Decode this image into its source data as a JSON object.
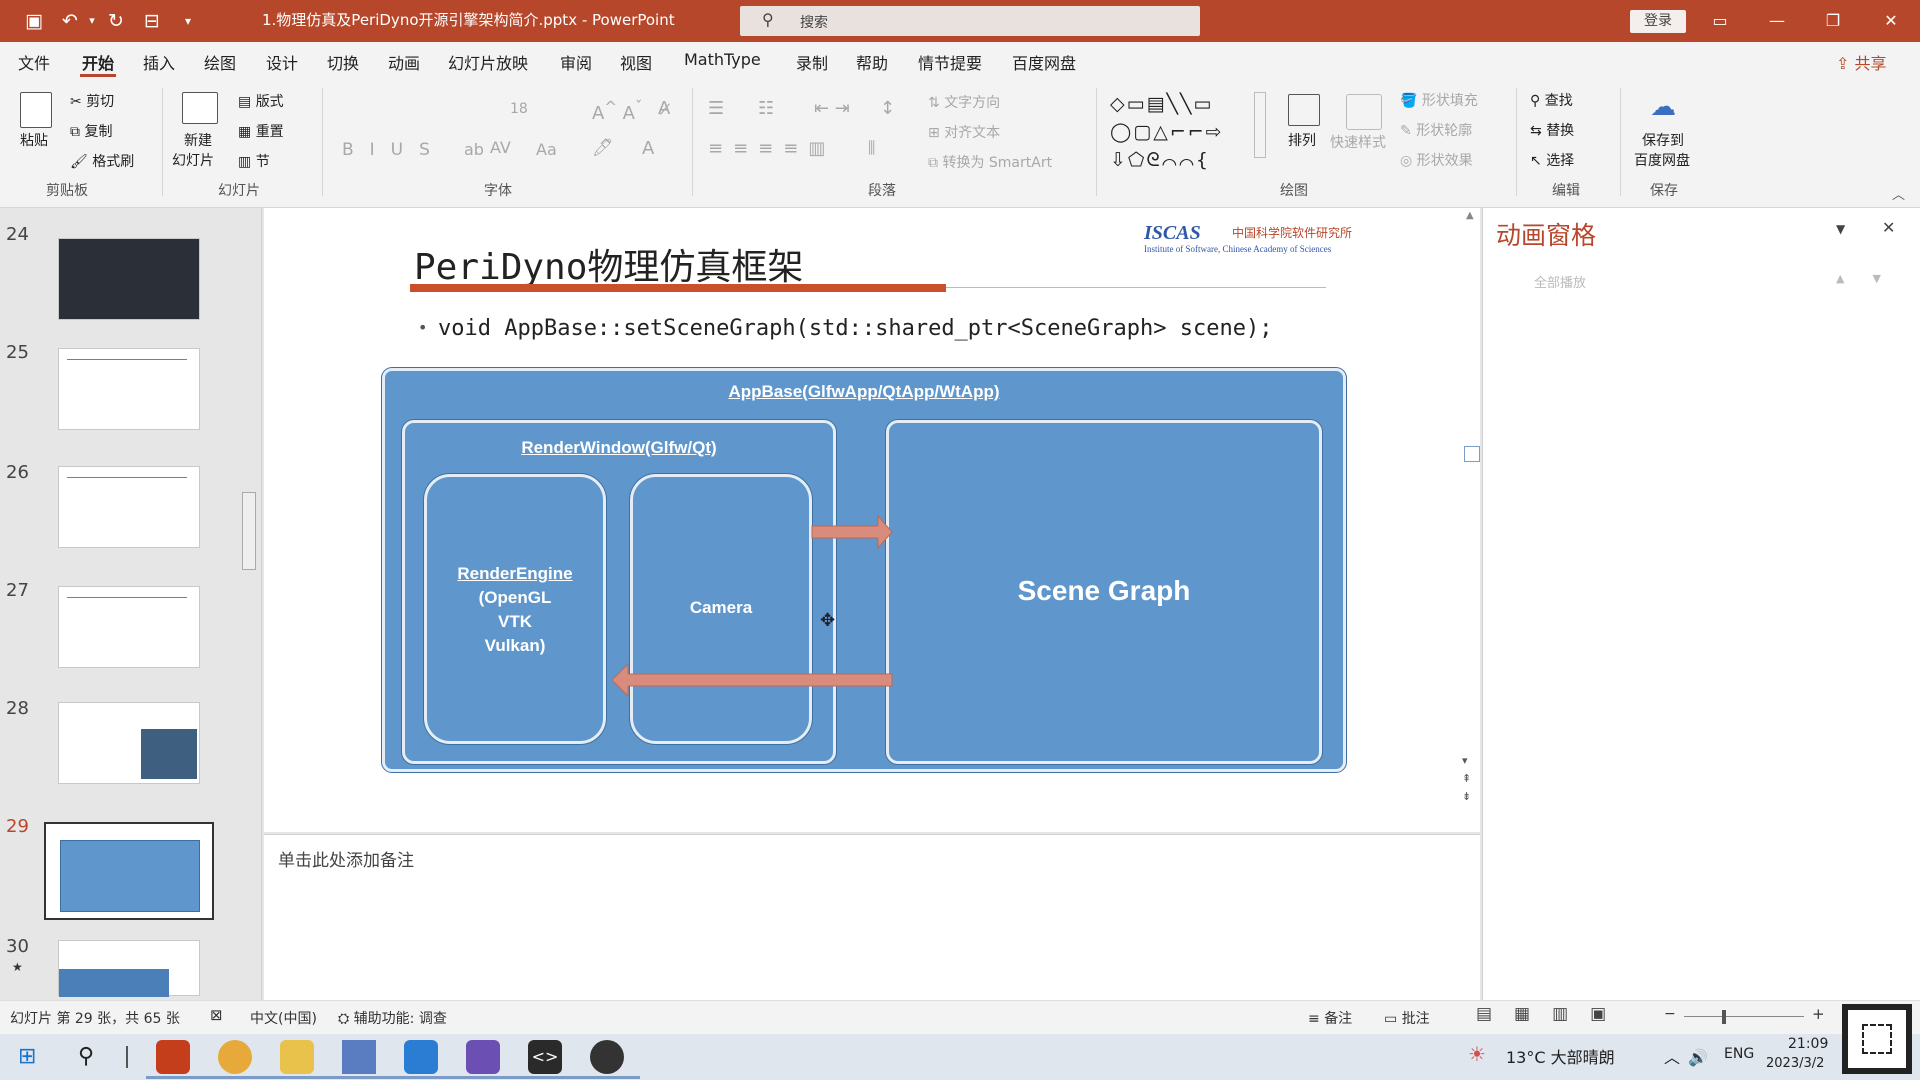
{
  "window": {
    "doc_title": "1.物理仿真及PeriDyno开源引擎架构简介.pptx  -  PowerPoint",
    "search_placeholder": "搜索",
    "login_label": "登录",
    "share_label": "共享"
  },
  "quick_access": [
    "save-icon",
    "undo-icon",
    "redo-icon",
    "present-icon",
    "more-icon"
  ],
  "menu": [
    "文件",
    "开始",
    "插入",
    "绘图",
    "设计",
    "切换",
    "动画",
    "幻灯片放映",
    "审阅",
    "视图",
    "MathType",
    "录制",
    "帮助",
    "情节提要",
    "百度网盘"
  ],
  "ribbon": {
    "clipboard": {
      "paste": "粘贴",
      "cut": "剪切",
      "copy": "复制",
      "format_painter": "格式刷",
      "group": "剪贴板"
    },
    "slides": {
      "new_slide_1": "新建",
      "new_slide_2": "幻灯片",
      "layout": "版式",
      "reset": "重置",
      "section": "节",
      "group": "幻灯片"
    },
    "font": {
      "size": "18",
      "group": "字体"
    },
    "paragraph": {
      "text_direction": "文字方向",
      "align_text": "对齐文本",
      "smartart": "转换为 SmartArt",
      "group": "段落"
    },
    "drawing": {
      "arrange": "排列",
      "quick_styles": "快速样式",
      "shape_fill": "形状填充",
      "shape_outline": "形状轮廓",
      "shape_effects": "形状效果",
      "group": "绘图"
    },
    "editing": {
      "find": "查找",
      "replace": "替换",
      "select": "选择",
      "group": "编辑"
    },
    "save": {
      "label_1": "保存到",
      "label_2": "百度网盘",
      "group": "保存"
    }
  },
  "thumbnails": [
    {
      "num": "24"
    },
    {
      "num": "25"
    },
    {
      "num": "26"
    },
    {
      "num": "27"
    },
    {
      "num": "28"
    },
    {
      "num": "29"
    },
    {
      "num": "30",
      "star": "★"
    }
  ],
  "slide": {
    "title": "PeriDyno物理仿真框架",
    "logo_text": "ISCAS",
    "logo_cn": "中国科学院软件研究所",
    "logo_en": "Institute of Software, Chinese Academy of Sciences",
    "bullet": "void AppBase::setSceneGraph(std::shared_ptr<SceneGraph> scene);",
    "app_base": "AppBase(GlfwApp/QtApp/WtApp)",
    "render_window": "RenderWindow(Glfw/Qt)",
    "render_engine": [
      "RenderEngine",
      "(OpenGL",
      "VTK",
      "Vulkan)"
    ],
    "camera": "Camera",
    "scene_graph": "Scene Graph"
  },
  "notes_placeholder": "单击此处添加备注",
  "animation_pane": {
    "title": "动画窗格",
    "play": "全部播放"
  },
  "status": {
    "slide_info": "幻灯片 第 29 张，共 65 张",
    "language": "中文(中国)",
    "accessibility": "辅助功能: 调查",
    "notes": "备注",
    "comments": "批注"
  },
  "taskbar": {
    "weather": "13°C  大部晴朗",
    "ime": "ENG",
    "time": "21:09",
    "date": "2023/3/2"
  },
  "colors": {
    "accent": "#b7472a",
    "diagram": "#5f97cc",
    "arrow": "#d98c7c"
  }
}
